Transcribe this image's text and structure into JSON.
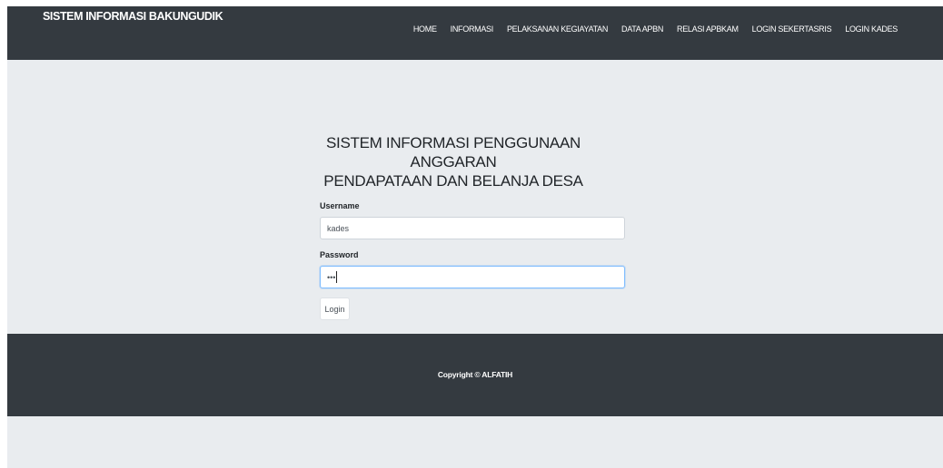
{
  "navbar": {
    "brand": "SISTEM INFORMASI BAKUNGUDIK",
    "links": [
      "HOME",
      "INFORMASI",
      "PELAKSANAN KEGIAYATAN",
      "DATA APBN",
      "RELASI APBKAM",
      "LOGIN SEKERTASRIS",
      "LOGIN KADES"
    ]
  },
  "form": {
    "title_line1": "SISTEM INFORMASI PENGGUNAAN ANGGARAN",
    "title_line2": "PENDAPATAAN DAN BELANJA DESA",
    "username_label": "Username",
    "username_value": "kades",
    "password_label": "Password",
    "password_value": "•••",
    "login_label": "Login"
  },
  "footer": {
    "copyright": "Copyright © ALFATIH"
  },
  "colors": {
    "navbar_bg": "#343a40",
    "page_bg": "#e9ecef",
    "focus_border": "#80bdff"
  }
}
